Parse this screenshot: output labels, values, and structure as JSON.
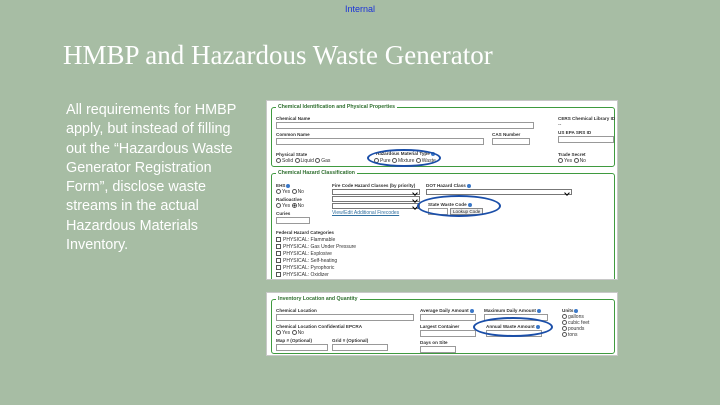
{
  "classification": "Internal",
  "slide": {
    "title": "HMBP and Hazardous Waste Generator",
    "body": "All requirements for HMBP apply, but instead of filling out the “Hazardous Waste Generator Registration Form”, disclose waste streams in the actual Hazardous Materials Inventory."
  },
  "colors": {
    "background": "#a7bda4",
    "highlight": "#1a4ea8",
    "section_border": "#3f9a3f"
  },
  "chem_section": {
    "legend": "Chemical Identification and Physical Properties",
    "chemical_name": "Chemical Name",
    "cers_library_id": "CERS Chemical Library ID",
    "cers_library_value": "--",
    "common_name": "Common Name",
    "cas_number": "CAS Number",
    "us_epa_srs_id": "US EPA SRS ID",
    "physical_state": "Physical State",
    "state_options": [
      "Solid",
      "Liquid",
      "Gas"
    ],
    "hazmat_type": "Hazardous Material Type",
    "type_options": [
      "Pure",
      "Mixture",
      "Waste"
    ],
    "trade_secret": "Trade Secret",
    "yes": "Yes",
    "no": "No"
  },
  "hazard_section": {
    "legend": "Chemical Hazard Classification",
    "ehs": "EHS",
    "fire_code": "Fire Code Hazard Classes (by priority)",
    "dot_class": "DOT Hazard Class",
    "radioactive": "Radioactive",
    "state_waste_code": "State Waste Code",
    "curies": "Curies",
    "view_edit_link": "View/Edit Additional Firecodes",
    "lookup_code": "Lookup Code",
    "fed_categories_label": "Federal Hazard Categories",
    "categories": [
      "PHYSICAL: Flammable",
      "PHYSICAL: Gas Under Pressure",
      "PHYSICAL: Explosive",
      "PHYSICAL: Self-heating",
      "PHYSICAL: Pyrophoric",
      "PHYSICAL: Oxidizer"
    ]
  },
  "inventory_section": {
    "legend": "Inventory Location and Quantity",
    "chemical_location": "Chemical Location",
    "avg_daily": "Average Daily Amount",
    "max_daily": "Maximum Daily Amount",
    "units": "Units",
    "unit_options": [
      "gallons",
      "cubic feet",
      "pounds",
      "tons"
    ],
    "confidential_epcra": "Chemical Location Confidential EPCRA",
    "largest_container": "Largest Container",
    "annual_waste": "Annual Waste Amount",
    "map_optional": "Map # (Optional)",
    "grid_optional": "Grid # (Optional)",
    "days_on_site": "Days on Site",
    "yes": "Yes",
    "no": "No"
  }
}
